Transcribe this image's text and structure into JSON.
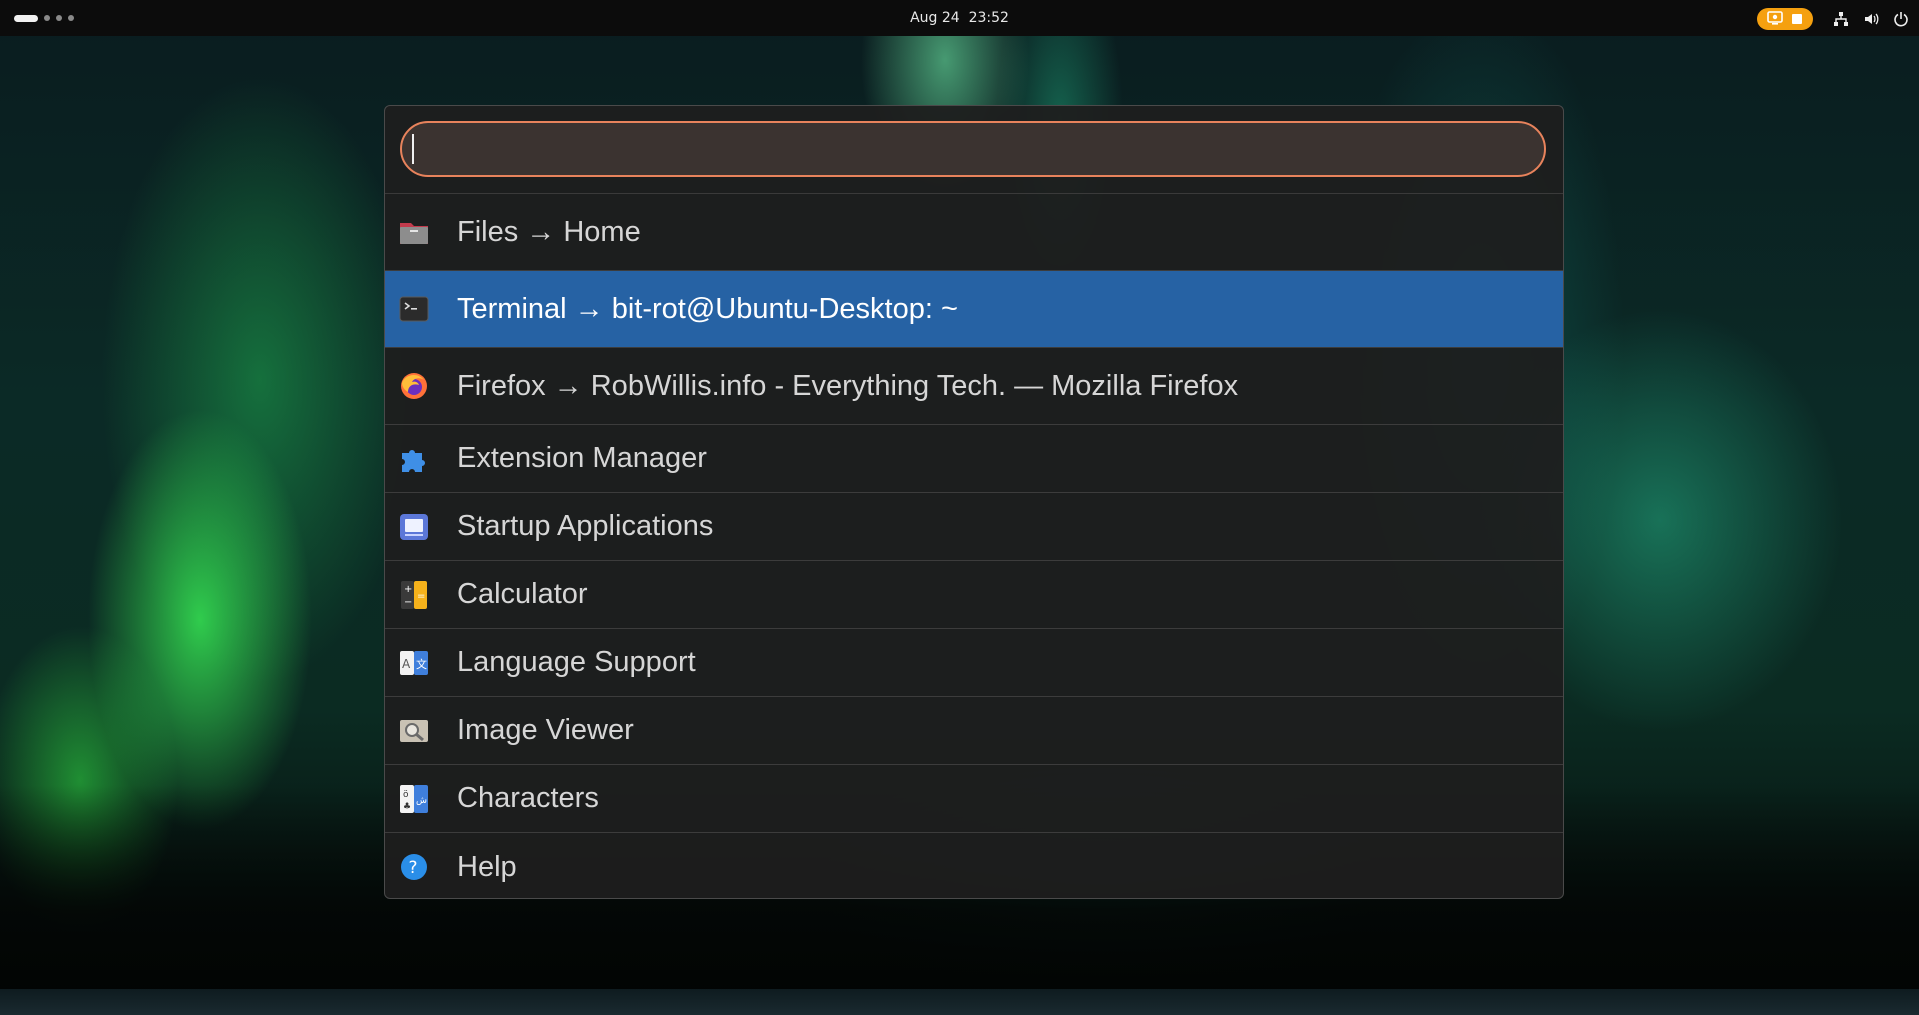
{
  "topbar": {
    "datetime": "Aug 24  23:52",
    "record_color": "#f5a00f",
    "icons": [
      "screen-record-icon",
      "stop-icon",
      "network-icon",
      "volume-icon",
      "power-icon"
    ]
  },
  "launcher": {
    "search": {
      "value": "",
      "placeholder": ""
    },
    "results": [
      {
        "label": "Files → Home",
        "icon": "files-folder-icon",
        "selected": false
      },
      {
        "label": "Terminal → bit-rot@Ubuntu-Desktop: ~",
        "icon": "terminal-icon",
        "selected": true
      },
      {
        "label": "Firefox → RobWillis.info - Everything Tech. — Mozilla Firefox",
        "icon": "firefox-icon",
        "selected": false
      },
      {
        "label": "Extension Manager",
        "icon": "puzzle-icon",
        "selected": false
      },
      {
        "label": "Startup Applications",
        "icon": "startup-apps-icon",
        "selected": false
      },
      {
        "label": "Calculator",
        "icon": "calculator-icon",
        "selected": false
      },
      {
        "label": "Language Support",
        "icon": "language-icon",
        "selected": false
      },
      {
        "label": "Image Viewer",
        "icon": "image-viewer-icon",
        "selected": false
      },
      {
        "label": "Characters",
        "icon": "characters-icon",
        "selected": false
      },
      {
        "label": "Help",
        "icon": "help-icon",
        "selected": false
      }
    ],
    "colors": {
      "accent_border": "#e8835c",
      "selection": "#2662a4"
    }
  }
}
